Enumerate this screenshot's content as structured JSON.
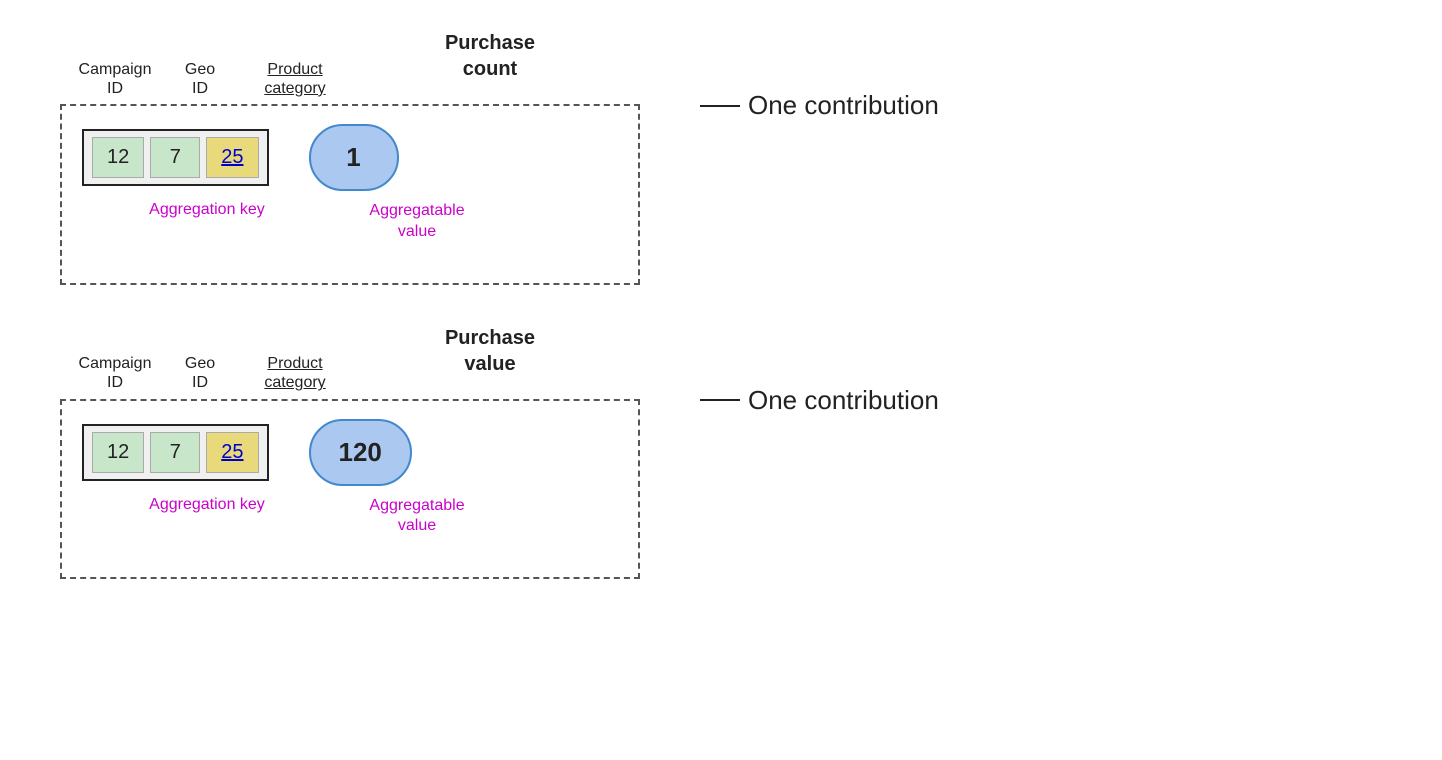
{
  "blocks": [
    {
      "id": "block1",
      "columns": {
        "campaign": {
          "label": "Campaign\nID",
          "value": "12"
        },
        "geo": {
          "label": "Geo\nID",
          "value": "7"
        },
        "product": {
          "label": "Product\ncategory",
          "value": "25"
        }
      },
      "purchase_header": "Purchase\ncount",
      "aggregatable_value": "1",
      "aggregation_key_label": "Aggregation key",
      "aggregatable_value_label": "Aggregatable\nvalue",
      "contribution_label": "One contribution"
    },
    {
      "id": "block2",
      "columns": {
        "campaign": {
          "label": "Campaign\nID",
          "value": "12"
        },
        "geo": {
          "label": "Geo\nID",
          "value": "7"
        },
        "product": {
          "label": "Product\ncategory",
          "value": "25"
        }
      },
      "purchase_header": "Purchase\nvalue",
      "aggregatable_value": "120",
      "aggregation_key_label": "Aggregation key",
      "aggregatable_value_label": "Aggregatable\nvalue",
      "contribution_label": "One contribution"
    }
  ]
}
